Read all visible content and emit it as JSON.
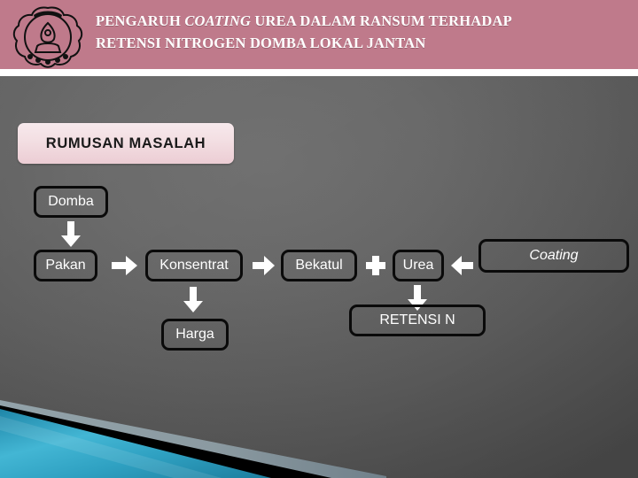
{
  "slide": {
    "header": {
      "logo_name": "uns-university-emblem",
      "title_line1_pre": "PENGARUH ",
      "title_line1_italic": "COATING",
      "title_line1_post": " UREA DALAM RANSUM  TERHADAP",
      "title_line2": "RETENSI NITROGEN DOMBA  LOKAL JANTAN",
      "background_color": "#bf7a8b",
      "text_color": "#ffffff"
    },
    "section": {
      "heading": "RUMUSAN MASALAH",
      "chip_color": "#f3dfe3",
      "chip_text_color": "#1a1a1a"
    },
    "diagram": {
      "node_border_color": "#0a0a0a",
      "node_text_color": "#ffffff",
      "arrow_color": "#ffffff",
      "nodes": [
        {
          "id": "domba",
          "label": "Domba",
          "italic": false
        },
        {
          "id": "pakan",
          "label": "Pakan",
          "italic": false
        },
        {
          "id": "konsentrat",
          "label": "Konsentrat",
          "italic": false
        },
        {
          "id": "bekatul",
          "label": "Bekatul",
          "italic": false
        },
        {
          "id": "urea",
          "label": "Urea",
          "italic": false
        },
        {
          "id": "coating",
          "label": "Coating",
          "italic": true
        },
        {
          "id": "harga",
          "label": "Harga",
          "italic": false
        },
        {
          "id": "retensi_n",
          "label": "RETENSI N",
          "italic": false
        }
      ],
      "connectors": [
        {
          "id": "domba-to-pakan",
          "glyph": "arrow-down",
          "from": "domba",
          "to": "pakan"
        },
        {
          "id": "pakan-to-konsentrat",
          "glyph": "arrow-right",
          "from": "pakan",
          "to": "konsentrat"
        },
        {
          "id": "konsentrat-to-bekatul",
          "glyph": "arrow-right",
          "from": "konsentrat",
          "to": "bekatul"
        },
        {
          "id": "bekatul-plus-urea",
          "glyph": "plus",
          "from": "bekatul",
          "to": "urea"
        },
        {
          "id": "coating-to-urea",
          "glyph": "arrow-left",
          "from": "coating",
          "to": "urea"
        },
        {
          "id": "konsentrat-to-harga",
          "glyph": "arrow-down",
          "from": "konsentrat",
          "to": "harga"
        },
        {
          "id": "urea-to-retensi",
          "glyph": "arrow-down",
          "from": "urea",
          "to": "retensi_n"
        }
      ]
    },
    "decoration": {
      "name": "bottom-left-diagonal-banner",
      "teal_color": "#2a9cbf",
      "black_color": "#000000",
      "gray_color": "#8d9ba1"
    }
  }
}
